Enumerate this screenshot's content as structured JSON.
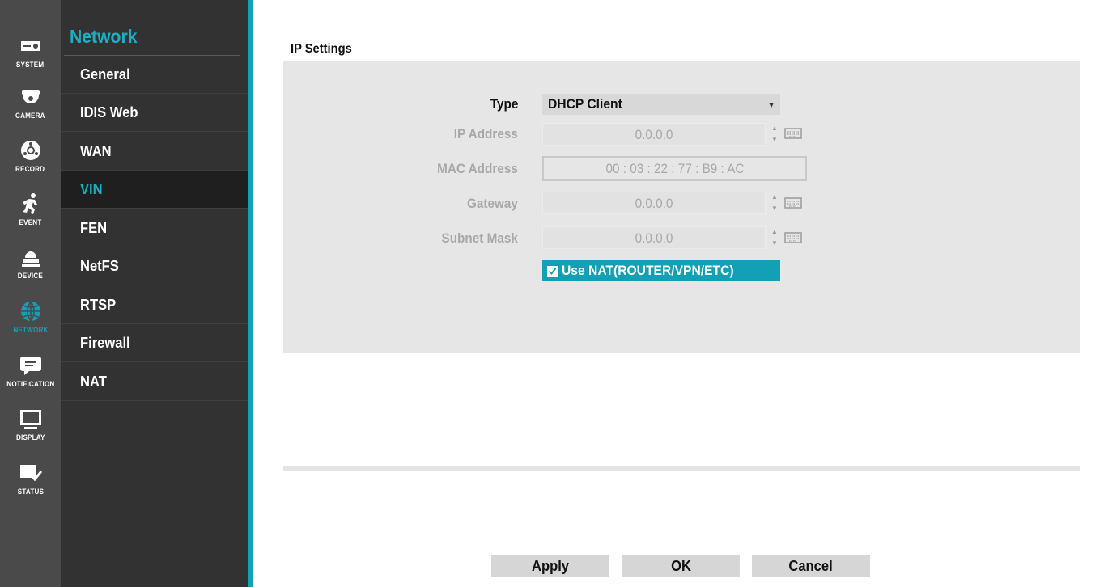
{
  "colors": {
    "accent": "#14a0b4",
    "rail_bg": "#4a4a4a",
    "submenu_bg": "#323232",
    "panel_bg": "#e6e6e6"
  },
  "rail": {
    "items": [
      {
        "label": "SYSTEM",
        "icon": "system-icon"
      },
      {
        "label": "CAMERA",
        "icon": "camera-icon"
      },
      {
        "label": "RECORD",
        "icon": "record-icon"
      },
      {
        "label": "EVENT",
        "icon": "event-icon"
      },
      {
        "label": "DEVICE",
        "icon": "device-icon"
      },
      {
        "label": "NETWORK",
        "icon": "network-icon",
        "active": true
      },
      {
        "label": "NOTIFICATION",
        "icon": "notification-icon"
      },
      {
        "label": "DISPLAY",
        "icon": "display-icon"
      },
      {
        "label": "STATUS",
        "icon": "status-icon"
      }
    ]
  },
  "submenu": {
    "title": "Network",
    "items": [
      {
        "label": "General"
      },
      {
        "label": "IDIS Web"
      },
      {
        "label": "WAN"
      },
      {
        "label": "VIN",
        "active": true
      },
      {
        "label": "FEN"
      },
      {
        "label": "NetFS"
      },
      {
        "label": "RTSP"
      },
      {
        "label": "Firewall"
      },
      {
        "label": "NAT"
      }
    ]
  },
  "ip_settings": {
    "title": "IP Settings",
    "type_label": "Type",
    "type_value": "DHCP Client",
    "ip_address_label": "IP Address",
    "ip_address_value": "0.0.0.0",
    "mac_address_label": "MAC Address",
    "mac_address_value": "00 : 03 : 22 : 77 : B9 : AC",
    "gateway_label": "Gateway",
    "gateway_value": "0.0.0.0",
    "subnet_mask_label": "Subnet Mask",
    "subnet_mask_value": "0.0.0.0",
    "use_nat_label": "Use NAT(ROUTER/VPN/ETC)",
    "use_nat_checked": true
  },
  "buttons": {
    "apply": "Apply",
    "ok": "OK",
    "cancel": "Cancel"
  }
}
